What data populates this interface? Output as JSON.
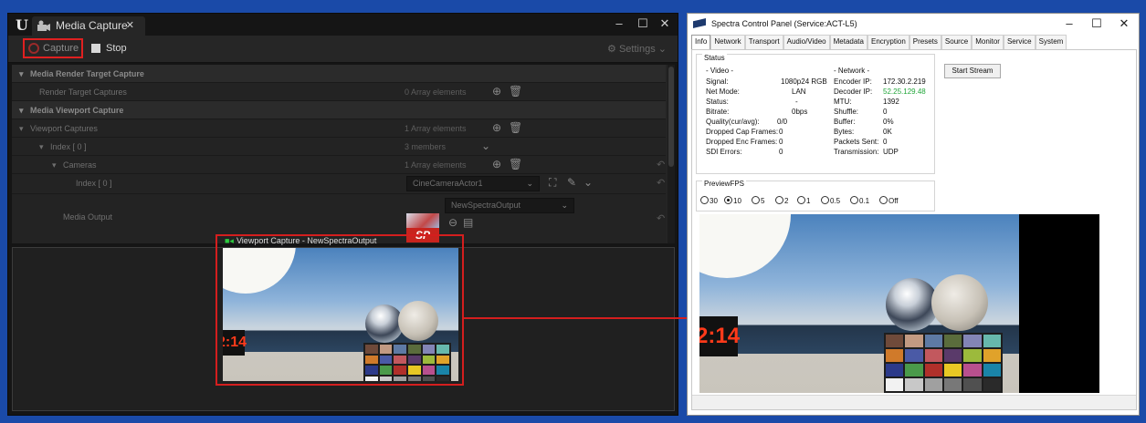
{
  "ue": {
    "tab_title": "Media Capture",
    "toolbar": {
      "capture_label": "Capture",
      "stop_label": "Stop",
      "settings_label": "Settings"
    },
    "sections": {
      "render_target": "Media Render Target Capture",
      "render_target_captures": "Render Target Captures",
      "render_target_captures_value": "0 Array elements",
      "viewport": "Media Viewport Capture",
      "viewport_captures": "Viewport Captures",
      "viewport_captures_value": "1 Array elements",
      "index0": "Index [ 0 ]",
      "index0_value": "3 members",
      "cameras": "Cameras",
      "cameras_value": "1 Array elements",
      "camera_index0": "Index [ 0 ]",
      "camera_actor": "CineCameraActor1",
      "media_output": "Media Output",
      "media_output_value": "NewSpectraOutput",
      "sp_thumb_text": "SP"
    },
    "viewport_title": "Viewport Capture - NewSpectraOutput",
    "clock_text": "2:14"
  },
  "spectra": {
    "title": "Spectra Control Panel (Service:ACT-L5)",
    "tabs": [
      "Info",
      "Network",
      "Transport",
      "Audio/Video",
      "Metadata",
      "Encryption",
      "Presets",
      "Source",
      "Monitor",
      "Service",
      "System"
    ],
    "status_legend": "Status",
    "video": {
      "header": "- Video -",
      "signal_label": "Signal:",
      "signal_value": "1080p24 RGB",
      "netmode_label": "Net Mode:",
      "netmode_value": "LAN",
      "status_label": "Status:",
      "status_value": "-",
      "bitrate_label": "Bitrate:",
      "bitrate_value": "0bps",
      "quality_label": "Quality(cur/avg):",
      "quality_value": "0/0",
      "dcf_label": "Dropped Cap Frames:",
      "dcf_value": "0",
      "def_label": "Dropped Enc Frames:",
      "def_value": "0",
      "sdi_label": "SDI Errors:",
      "sdi_value": "0"
    },
    "network": {
      "header": "- Network -",
      "encoder_label": "Encoder IP:",
      "encoder_value": "172.30.2.219",
      "decoder_label": "Decoder IP:",
      "decoder_value": "52.25.129.48",
      "mtu_label": "MTU:",
      "mtu_value": "1392",
      "shuffle_label": "Shuffle:",
      "shuffle_value": "0",
      "buffer_label": "Buffer:",
      "buffer_value": "0%",
      "bytes_label": "Bytes:",
      "bytes_value": "0K",
      "packets_label": "Packets Sent:",
      "packets_value": "0",
      "transmission_label": "Transmission:",
      "transmission_value": "UDP"
    },
    "start_stream": "Start Stream",
    "fps_legend": "PreviewFPS",
    "fps_options": [
      "30",
      "10",
      "5",
      "2",
      "1",
      "0.5",
      "0.1",
      "Off"
    ],
    "fps_selected": "10",
    "clock_text": "2:14"
  },
  "colors": {
    "accent_red": "#d41e1e",
    "decoder_ip_green": "#22a63a",
    "desktop_blue": "#1a4aa8"
  }
}
